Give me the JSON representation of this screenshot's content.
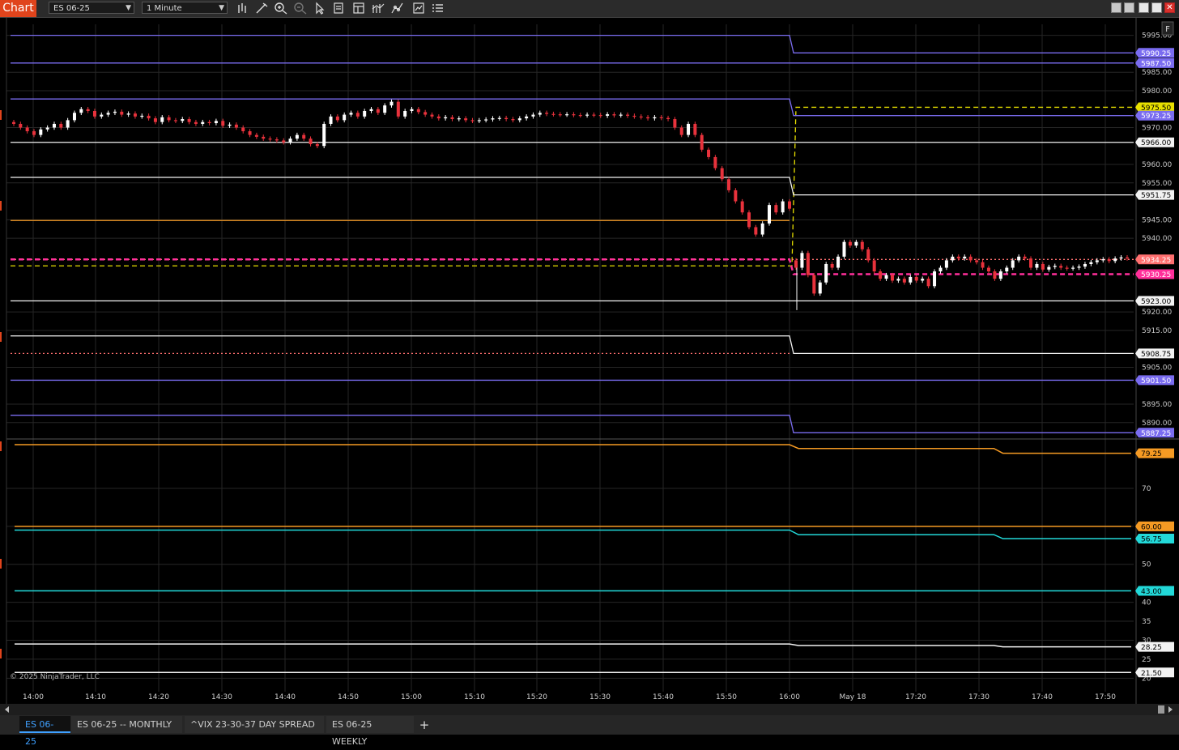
{
  "toolbar": {
    "chart_label": "Chart",
    "instrument": "ES 06-25",
    "interval": "1 Minute",
    "f_label": "F"
  },
  "copyright": "© 2025 NinjaTrader, LLC",
  "tabs": [
    {
      "label": "ES 06-25",
      "active": true
    },
    {
      "label": "ES 06-25 -- MONTHLY",
      "active": false
    },
    {
      "label": "^VIX 23-30-37 DAY SPREAD",
      "active": false
    },
    {
      "label": "ES 06-25 WEEKLY",
      "active": false
    }
  ],
  "add_tab": "+",
  "colors": {
    "background": "#000000",
    "grid": "#262626",
    "up": "#ffffff",
    "down": "#e8323c",
    "purple": "#7a6cf0",
    "orange": "#f59a23",
    "yellow": "#e8e000",
    "magenta": "#ff2f9a",
    "cyan": "#22d8d8",
    "white": "#f2f2f2",
    "salmon": "#ff6f6f"
  },
  "chart_data": {
    "type": "candlestick",
    "price_ticks": [
      "5995.00",
      "5985.00",
      "5980.00",
      "5970.00",
      "5960.00",
      "5955.00",
      "5945.00",
      "5940.00",
      "5920.00",
      "5915.00",
      "5905.00",
      "5895.00",
      "5890.00"
    ],
    "price_range": [
      5886,
      5998
    ],
    "indicator_ticks": [
      "70",
      "60",
      "50",
      "40",
      "35",
      "30",
      "25",
      "20"
    ],
    "indicator_range": [
      19,
      83
    ],
    "time_labels": [
      "14:00",
      "14:10",
      "14:20",
      "14:30",
      "14:40",
      "14:50",
      "15:00",
      "15:10",
      "15:20",
      "15:30",
      "15:40",
      "15:50",
      "16:00",
      "May 18",
      "17:20",
      "17:30",
      "17:40",
      "17:50"
    ],
    "price_levels": [
      {
        "label": "5990.25",
        "color": "purple",
        "before": 5995.0,
        "after": 5990.25,
        "style": "solid"
      },
      {
        "label": "5987.50",
        "color": "purple",
        "before": 5987.5,
        "after": 5987.5,
        "style": "solid"
      },
      {
        "label": "5975.50",
        "color": "yellow",
        "before": 5932.5,
        "after": 5975.5,
        "style": "dashed"
      },
      {
        "label": "5973.25",
        "color": "purple",
        "before": 5977.75,
        "after": 5973.25,
        "style": "solid"
      },
      {
        "label": "5966.00",
        "color": "white",
        "before": 5966.0,
        "after": 5966.0,
        "style": "solid"
      },
      {
        "label": "5951.75",
        "color": "white",
        "before": 5956.5,
        "after": 5951.75,
        "style": "solid"
      },
      {
        "label": "",
        "color": "orange",
        "before": 5944.8,
        "after": null,
        "style": "solid"
      },
      {
        "label": "5934.25",
        "color": "salmon",
        "before": 5934.25,
        "after": 5934.25,
        "style": "dotted"
      },
      {
        "label": "5930.25",
        "color": "magenta",
        "before": 5934.25,
        "after": 5930.25,
        "style": "dashed"
      },
      {
        "label": "5923.00",
        "color": "white",
        "before": 5923.0,
        "after": 5923.0,
        "style": "solid"
      },
      {
        "label": "5908.75",
        "color": "white",
        "before": 5913.5,
        "after": 5908.75,
        "style": "solid"
      },
      {
        "label": "",
        "color": "salmon",
        "before": 5908.75,
        "after": null,
        "style": "dotted"
      },
      {
        "label": "5901.50",
        "color": "purple",
        "before": 5901.5,
        "after": 5901.5,
        "style": "solid"
      },
      {
        "label": "5887.25",
        "color": "purple",
        "before": 5892.0,
        "after": 5887.25,
        "style": "solid"
      }
    ],
    "indicator_lines": [
      {
        "label": "79.25",
        "color": "orange",
        "points": [
          [
            0,
            81.5
          ],
          [
            0.694,
            81.5
          ],
          [
            0.702,
            80.5
          ],
          [
            0.877,
            80.5
          ],
          [
            0.885,
            79.25
          ],
          [
            1,
            79.25
          ]
        ]
      },
      {
        "label": "56.75",
        "color": "cyan",
        "points": [
          [
            0,
            59.0
          ],
          [
            0.694,
            59.0
          ],
          [
            0.702,
            57.8
          ],
          [
            0.877,
            57.8
          ],
          [
            0.885,
            56.75
          ],
          [
            1,
            56.75
          ]
        ]
      },
      {
        "label": "28.25",
        "color": "white",
        "points": [
          [
            0,
            29.0
          ],
          [
            0.694,
            29.0
          ],
          [
            0.702,
            28.6
          ],
          [
            0.877,
            28.6
          ],
          [
            0.885,
            28.25
          ],
          [
            1,
            28.25
          ]
        ]
      },
      {
        "label": "60.00",
        "color": "orange",
        "points": [
          [
            0,
            60.0
          ],
          [
            1,
            60.0
          ]
        ]
      },
      {
        "label": "43.00",
        "color": "cyan",
        "points": [
          [
            0,
            43.0
          ],
          [
            1,
            43.0
          ]
        ]
      },
      {
        "label": "21.50",
        "color": "white",
        "points": [
          [
            0,
            21.5
          ],
          [
            1,
            21.5
          ]
        ]
      }
    ],
    "session1_closes": [
      5971,
      5970,
      5969,
      5968,
      5969.5,
      5970,
      5971,
      5970,
      5972,
      5974,
      5975,
      5974.5,
      5973,
      5973.5,
      5974,
      5974.3,
      5973.5,
      5973.8,
      5973,
      5973.2,
      5972.5,
      5971.5,
      5972.8,
      5972,
      5971.8,
      5972.3,
      5971.5,
      5971,
      5971.5,
      5971.2,
      5971.8,
      5970.5,
      5970.8,
      5970,
      5969,
      5968,
      5967.5,
      5967,
      5966.8,
      5966.5,
      5966,
      5967,
      5968,
      5967,
      5965.5,
      5965,
      5971,
      5973,
      5972,
      5973.5,
      5974,
      5973,
      5974.5,
      5975,
      5974,
      5976,
      5977,
      5973,
      5974.5,
      5975,
      5974.2,
      5973.5,
      5973,
      5972.5,
      5972.8,
      5972.3,
      5972.5,
      5972,
      5971.8,
      5972,
      5972.2,
      5972.5,
      5972.6,
      5972.3,
      5972,
      5972.5,
      5973,
      5973.5,
      5974,
      5973.7,
      5973.6,
      5973.5,
      5973.6,
      5973.4,
      5973.3,
      5973.5,
      5973.4,
      5973.2,
      5973.6,
      5973.3,
      5973.5,
      5973.2,
      5973,
      5972.8,
      5972.5,
      5972.8,
      5972.6,
      5972.3,
      5970,
      5968,
      5971,
      5968,
      5964,
      5962,
      5959,
      5956,
      5953,
      5950,
      5947,
      5943,
      5941,
      5944,
      5949,
      5947,
      5950,
      5948
    ],
    "session2_closes": [
      5932,
      5936,
      5930,
      5925,
      5928,
      5933,
      5932,
      5935,
      5939,
      5938,
      5939,
      5937,
      5934,
      5931,
      5929,
      5930,
      5928.5,
      5929,
      5928,
      5929.5,
      5928.5,
      5929,
      5927,
      5931,
      5932,
      5934,
      5935,
      5934.5,
      5935,
      5934,
      5933.5,
      5932,
      5931,
      5929,
      5931,
      5932,
      5934,
      5935,
      5934.5,
      5932,
      5933,
      5931.5,
      5932.2,
      5932.5,
      5932,
      5931.8,
      5932,
      5932.3,
      5933,
      5933.5,
      5934,
      5934.3,
      5933.8,
      5934.5,
      5934.8,
      5934.5
    ]
  }
}
